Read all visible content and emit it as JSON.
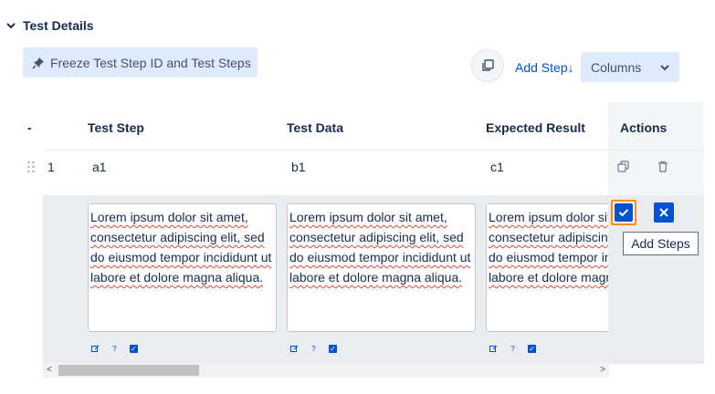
{
  "section": {
    "title": "Test Details"
  },
  "toolbar": {
    "freeze_label": "Freeze Test Step ID and Test Steps",
    "add_step_label": "Add Step↓",
    "columns_label": "Columns"
  },
  "table": {
    "headers": {
      "index": "-",
      "test_step": "Test Step",
      "test_data": "Test Data",
      "expected": "Expected Result",
      "actions": "Actions"
    },
    "rows": [
      {
        "index": "1",
        "test_step": "a1",
        "test_data": "b1",
        "expected": "c1"
      }
    ],
    "edit_row": {
      "test_step": "Lorem ipsum dolor sit amet, consectetur adipiscing elit, sed do eiusmod tempor incididunt ut labore et dolore magna aliqua.",
      "test_data": "Lorem ipsum dolor sit amet, consectetur adipiscing elit, sed do eiusmod tempor incididunt ut labore et dolore magna aliqua.",
      "expected": "Lorem ipsum dolor sit amet, consectetur adipiscing elit, sed do eiusmod tempor incididunt ut labore et dolore magna aliqua."
    }
  },
  "tooltip": {
    "text": "Add Steps"
  },
  "mini_tools": {
    "help": "?"
  },
  "scroll": {
    "left": "<",
    "right": ">"
  },
  "colors": {
    "accent": "#0052cc",
    "focus": "#ff8b00",
    "button_bg": "#deebff"
  }
}
